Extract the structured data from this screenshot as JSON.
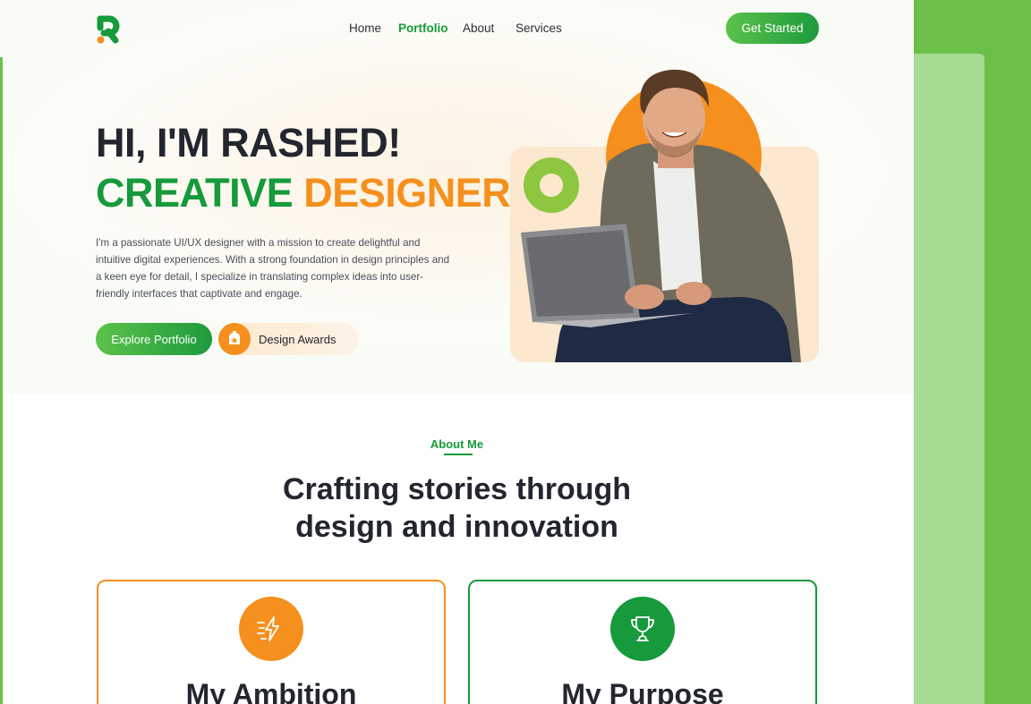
{
  "nav": {
    "items": [
      "Home",
      "Portfolio",
      "About",
      "Services"
    ],
    "active": "Portfolio",
    "cta_label": "Get Started"
  },
  "hero": {
    "greeting": "HI, I'M RASHED!",
    "role_part1": "CREATIVE",
    "role_part2": "DESIGNER",
    "intro": "I'm a passionate UI/UX designer with a mission to create delightful and intuitive digital experiences. With a strong foundation in design principles and a keen eye for detail, I specialize in translating complex ideas into  user-friendly interfaces that captivate and engage.",
    "explore_label": "Explore Portfolio",
    "awards_label": "Design Awards"
  },
  "about": {
    "label": "About Me",
    "title_line1": "Crafting stories through",
    "title_line2": "design and innovation"
  },
  "cards": [
    {
      "title": "My Ambition",
      "icon": "lightning-icon"
    },
    {
      "title": "My Purpose",
      "icon": "trophy-icon"
    }
  ],
  "colors": {
    "brand_green": "#169a3b",
    "brand_orange": "#f5901e",
    "dark_text": "#23262f",
    "outer_green": "#6cc04a"
  }
}
